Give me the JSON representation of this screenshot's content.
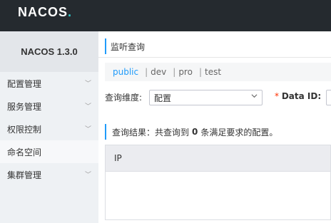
{
  "header": {
    "logo_main": "NACOS",
    "logo_dot": "."
  },
  "sidebar": {
    "version": "NACOS 1.3.0",
    "items": [
      {
        "label": "配置管理",
        "has_children": true
      },
      {
        "label": "服务管理",
        "has_children": true
      },
      {
        "label": "权限控制",
        "has_children": true
      },
      {
        "label": "命名空间",
        "has_children": false,
        "active": true
      },
      {
        "label": "集群管理",
        "has_children": true
      }
    ]
  },
  "main": {
    "title": "监听查询",
    "namespaces": [
      "public",
      "dev",
      "pro",
      "test"
    ],
    "active_namespace": "public",
    "filter": {
      "dimension_label": "查询维度:",
      "dimension_value": "配置",
      "required_mark": "*",
      "dataid_label": "Data ID:"
    },
    "result": {
      "prefix": "查询结果：共查询到",
      "count": "0",
      "suffix": "条满足要求的配置。"
    },
    "table": {
      "columns": [
        "IP"
      ]
    }
  },
  "colors": {
    "topbar": "#252a2f",
    "accent": "#209bfa",
    "logo_dot": "#2ec8ca"
  }
}
